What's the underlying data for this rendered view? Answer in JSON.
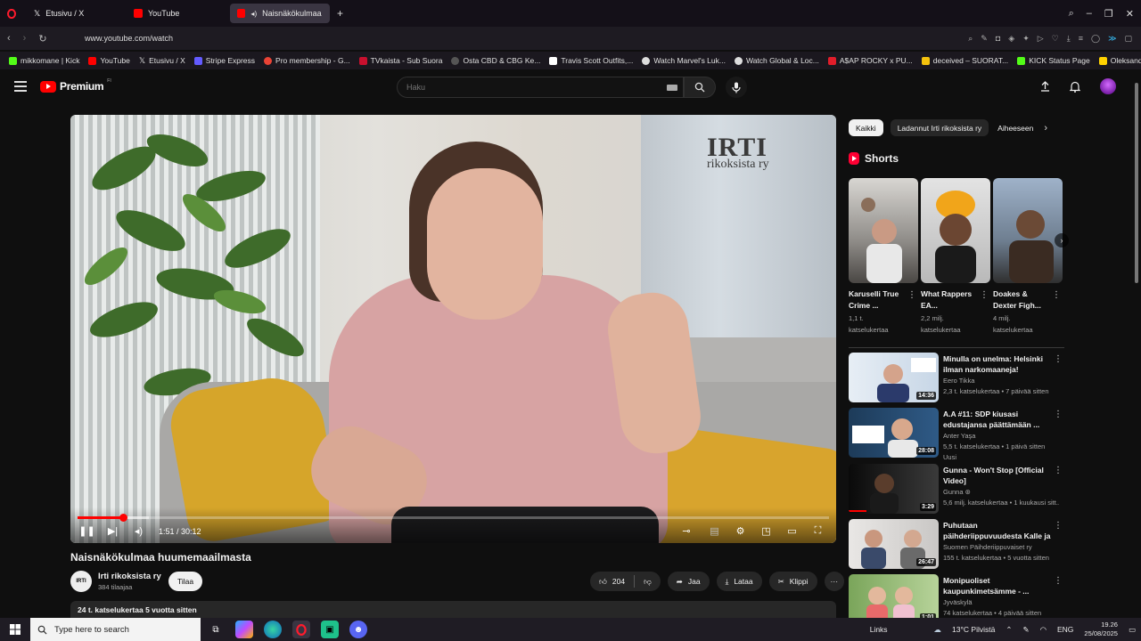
{
  "browser": {
    "tabs": [
      {
        "label": "Etusivu / X",
        "active": false,
        "icon": "x-logo-icon"
      },
      {
        "label": "YouTube",
        "active": false,
        "icon": "youtube-icon"
      },
      {
        "label": "Naisnäkökulmaa huu",
        "active": true,
        "icon": "youtube-icon"
      }
    ],
    "new_tab": "+",
    "url": "www.youtube.com/watch",
    "bookmarks": [
      {
        "label": "mikkomane | Kick",
        "color": "#53fc18"
      },
      {
        "label": "YouTube",
        "color": "#ff0000"
      },
      {
        "label": "Etusivu / X",
        "color": "#ffffff"
      },
      {
        "label": "Stripe Express",
        "color": "#635bff"
      },
      {
        "label": "Pro membership - G...",
        "color": "#ea4335"
      },
      {
        "label": "TVkaista - Sub Suora",
        "color": "#c8102e"
      },
      {
        "label": "Osta CBD & CBG Ke...",
        "color": "#555555"
      },
      {
        "label": "Travis Scott Outfits,...",
        "color": "#ffffff"
      },
      {
        "label": "Watch Marvel's Luk...",
        "color": "#dddddd"
      },
      {
        "label": "Watch Global & Loc...",
        "color": "#dddddd"
      },
      {
        "label": "A$AP ROCKY x PU...",
        "color": "#e11d2a"
      },
      {
        "label": "deceived – SUORAT...",
        "color": "#f4c20d"
      },
      {
        "label": "KICK Status Page",
        "color": "#53fc18"
      },
      {
        "label": "Oleksandr Usyk vs D...",
        "color": "#ffd200"
      }
    ]
  },
  "youtube": {
    "logo_text": "Premium",
    "logo_sup": "FI",
    "search_placeholder": "Haku",
    "video": {
      "watermark_line1": "IRTI",
      "watermark_line2": "rikoksista ry",
      "time": "1:51 / 30:12",
      "progress": 0.061,
      "buffered": 0.095,
      "title": "Naisnäkökulmaa huumemaailmasta"
    },
    "channel": {
      "avatar_text": "IRTI",
      "name": "Irti rikoksista ry",
      "subs": "384 tilaajaa",
      "subscribe": "Tilaa"
    },
    "actions": {
      "likes": "204",
      "share": "Jaa",
      "download": "Lataa",
      "clip": "Klippi",
      "more": "···"
    },
    "description": "24 t. katselukertaa  5 vuotta sitten",
    "chips": [
      "Kaikki",
      "Ladannut Irti rikoksista ry",
      "Aiheeseen"
    ],
    "shorts_title": "Shorts",
    "shorts": [
      {
        "title": "Karuselli True Crime ...",
        "views": "1,1 t.",
        "views2": "katselukertaa"
      },
      {
        "title": "What Rappers EA...",
        "views": "2,2 milj.",
        "views2": "katselukertaa"
      },
      {
        "title": "Doakes & Dexter Figh...",
        "views": "4 milj.",
        "views2": "katselukertaa"
      }
    ],
    "recommended": [
      {
        "title": "Minulla on unelma: Helsinki ilman narkomaaneja!",
        "channel": "Eero Tikka",
        "meta": "2,3 t. katselukertaa • 7 päivää sitten",
        "badge": "",
        "duration": "14:36"
      },
      {
        "title": "A.A #11: SDP kiusasi edustajansa päättämään ...",
        "channel": "Anter Yaşa",
        "meta": "5,5 t. katselukertaa • 1 päivä sitten",
        "badge": "Uusi",
        "duration": "28:08"
      },
      {
        "title": "Gunna - Won't Stop [Official Video]",
        "channel": "Gunna ⊛",
        "meta": "5,6 milj. katselukertaa • 1 kuukausi sitt...",
        "badge": "",
        "duration": "3:29"
      },
      {
        "title": "Puhutaan päihderiippuvuudesta Kalle ja Katri Lähde",
        "channel": "Suomen Päihderiippuvaiset ry",
        "meta": "155 t. katselukertaa • 5 vuotta sitten",
        "badge": "",
        "duration": "26:47"
      },
      {
        "title": "Monipuoliset kaupunkimetsämme - ...",
        "channel": "Jyväskylä",
        "meta": "74 katselukertaa • 4 päivää sitten",
        "badge": "",
        "duration": "1:01"
      }
    ]
  },
  "taskbar": {
    "search_placeholder": "Type here to search",
    "links": "Links",
    "weather": "13°C  Pilvistä",
    "lang": "ENG",
    "time": "19.26",
    "date": "25/08/2025"
  }
}
